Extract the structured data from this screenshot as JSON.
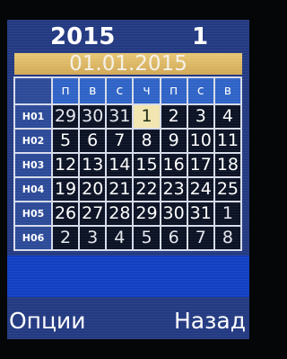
{
  "header": {
    "year": "2015",
    "month": "1"
  },
  "selected_date": "01.01.2015",
  "calendar": {
    "weekday_headers": [
      "п",
      "в",
      "с",
      "ч",
      "п",
      "с",
      "в"
    ],
    "weeks": [
      {
        "label": "Н01",
        "days": [
          "29",
          "30",
          "31",
          "1",
          "2",
          "3",
          "4"
        ]
      },
      {
        "label": "Н02",
        "days": [
          "5",
          "6",
          "7",
          "8",
          "9",
          "10",
          "11"
        ]
      },
      {
        "label": "Н03",
        "days": [
          "12",
          "13",
          "14",
          "15",
          "16",
          "17",
          "18"
        ]
      },
      {
        "label": "Н04",
        "days": [
          "19",
          "20",
          "21",
          "22",
          "23",
          "24",
          "25"
        ]
      },
      {
        "label": "Н05",
        "days": [
          "26",
          "27",
          "28",
          "29",
          "30",
          "31",
          "1"
        ]
      },
      {
        "label": "Н06",
        "days": [
          "2",
          "3",
          "4",
          "5",
          "6",
          "7",
          "8"
        ]
      }
    ]
  },
  "softkeys": {
    "left": "Опции",
    "right": "Назад"
  },
  "colors": {
    "background": "#233a82",
    "date_bar": "#d9b15f",
    "selected_day": "#f1e6b0",
    "weekday_header": "#2f63c6",
    "bottom_strip": "#123fc2"
  }
}
